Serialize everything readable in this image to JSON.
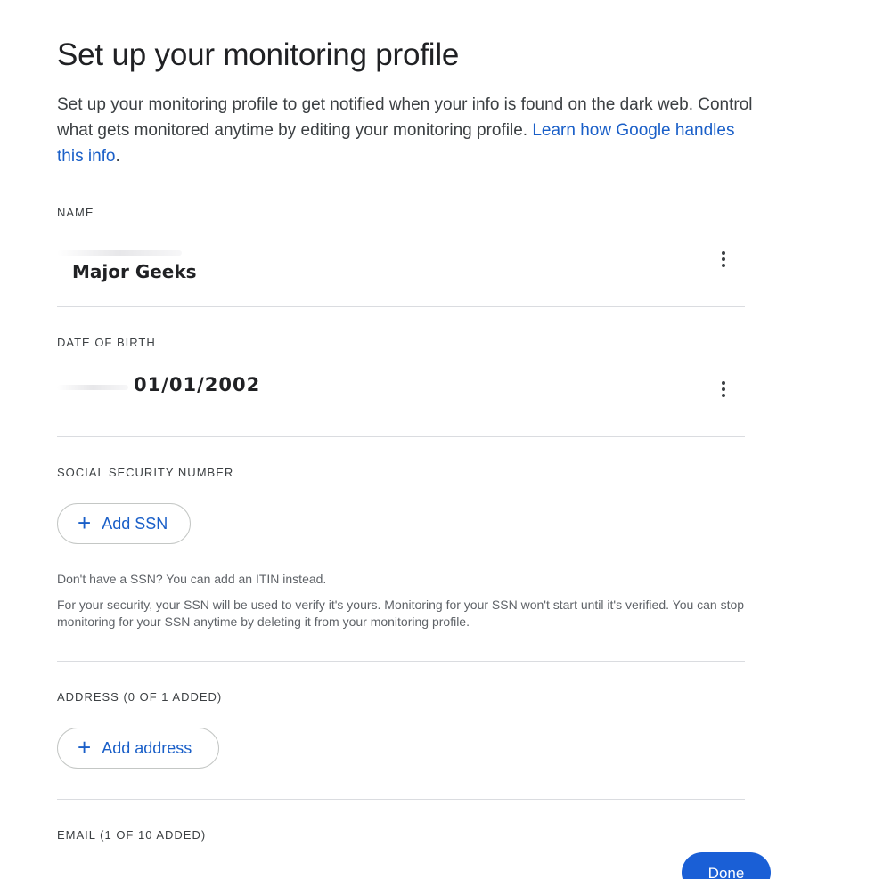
{
  "page": {
    "title": "Set up your monitoring profile",
    "intro_text": "Set up your monitoring profile to get notified when your info is found on the dark web. Control what gets monitored anytime by editing your monitoring profile.",
    "learn_link": "Learn how Google handles this info",
    "intro_end": "."
  },
  "name_section": {
    "label": "NAME",
    "value": "Major Geeks",
    "menu_icon": "more-vert-icon"
  },
  "dob_section": {
    "label": "DATE OF BIRTH",
    "value": "01/01/2002",
    "menu_icon": "more-vert-icon"
  },
  "ssn_section": {
    "label": "SOCIAL SECURITY NUMBER",
    "button_label": "Add SSN",
    "button_icon": "plus-icon",
    "note_itin": "Don't have a SSN? You can add an ITIN instead.",
    "note_security": "For your security, your SSN will be used to verify it's yours. Monitoring for your SSN won't start until it's verified. You can stop monitoring for your SSN anytime by deleting it from your monitoring profile."
  },
  "address_section": {
    "label": "ADDRESS (0 OF 1 ADDED)",
    "button_label": "Add address",
    "button_icon": "plus-icon"
  },
  "email_section": {
    "label": "EMAIL (1 OF 10 ADDED)"
  },
  "footer": {
    "done_label": "Done"
  },
  "colors": {
    "accent": "#1a5fc8",
    "primary_button": "#1a5fd6",
    "divider": "#dadce0"
  }
}
